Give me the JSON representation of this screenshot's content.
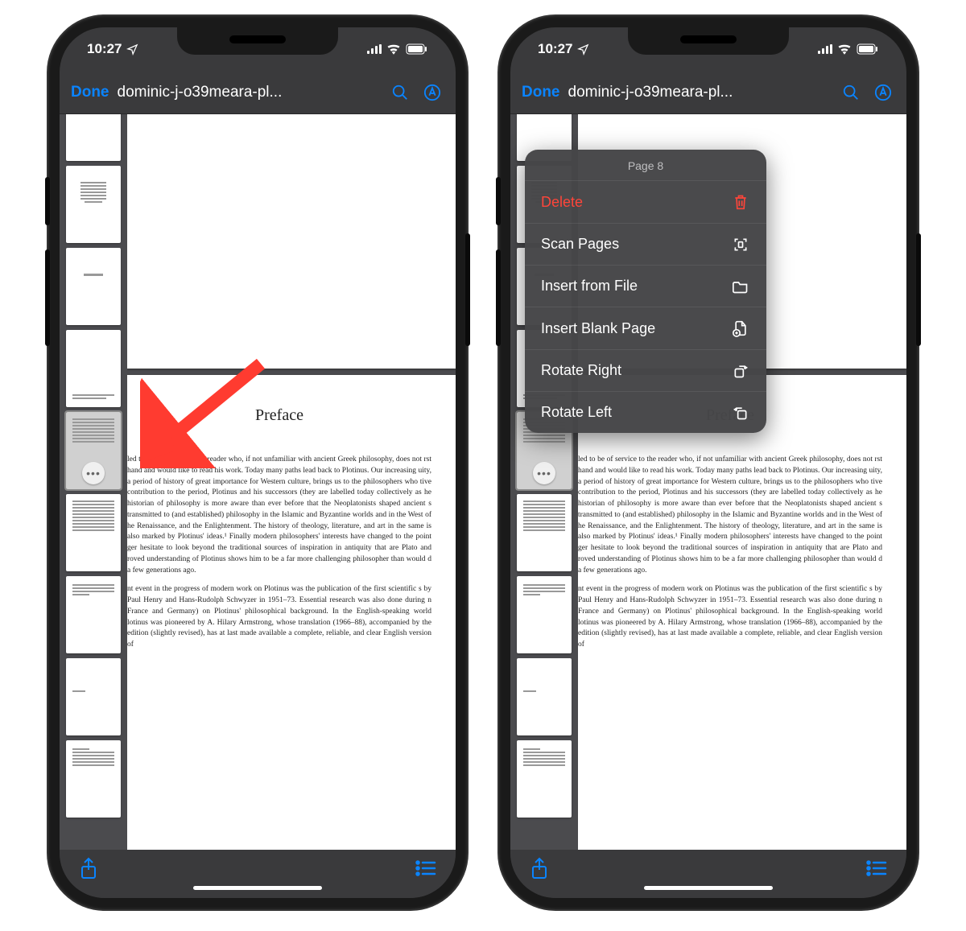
{
  "status": {
    "time": "10:27"
  },
  "nav": {
    "done": "Done",
    "title": "dominic-j-o39meara-pl..."
  },
  "doc": {
    "preface_title": "Preface",
    "para1": "led to be of service to the reader who, if not unfamiliar with ancient Greek philosophy, does not rst hand and would like to read his work. Today many paths lead back to Plotinus. Our increasing uity, a period of history of great importance for Western culture, brings us to the philosophers who tive contribution to the period, Plotinus and his successors (they are labelled today collectively as he historian of philosophy is more aware than ever before that the Neoplatonists shaped ancient s transmitted to (and established) philosophy in the Islamic and Byzantine worlds and in the West of he Renaissance, and the Enlightenment. The history of theology, literature, and art in the same is also marked by Plotinus' ideas.¹ Finally modern philosophers' interests have changed to the point ger hesitate to look beyond the traditional sources of inspiration in antiquity that are Plato and roved understanding of Plotinus shows him to be a far more challenging philosopher than would d a few generations ago.",
    "para2": "nt event in the progress of modern work on Plotinus was the publication of the first scientific s by Paul Henry and Hans-Rudolph Schwyzer in 1951–73. Essential research was also done during n France and Germany) on Plotinus' philosophical background. In the English-speaking world lotinus was pioneered by A. Hilary Armstrong, whose translation (1966–88), accompanied by the edition (slightly revised), has at last made available a complete, reliable, and clear English version of"
  },
  "menu": {
    "header": "Page 8",
    "delete": "Delete",
    "scan": "Scan Pages",
    "insert_file": "Insert from File",
    "insert_blank": "Insert Blank Page",
    "rotate_right": "Rotate Right",
    "rotate_left": "Rotate Left"
  }
}
